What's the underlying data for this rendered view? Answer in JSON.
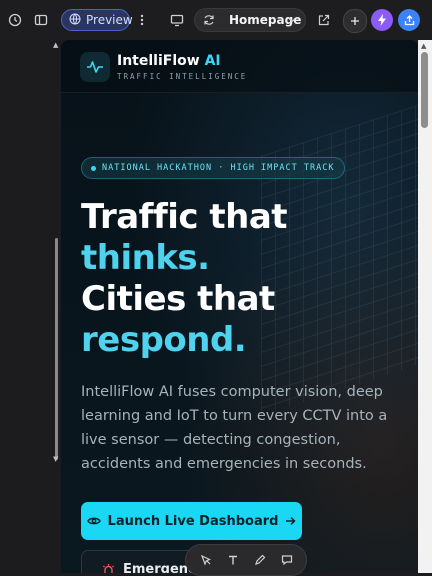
{
  "toolbar": {
    "preview_label": "Preview",
    "page_selected": "Homepage"
  },
  "site": {
    "brand_name": "IntelliFlow",
    "brand_ai": "AI",
    "tagline": "TRAFFIC INTELLIGENCE"
  },
  "hero": {
    "badge": "NATIONAL HACKATHON · HIGH IMPACT TRACK",
    "line1": "Traffic that",
    "line2": "thinks.",
    "line3": "Cities that",
    "line4": "respond.",
    "description": "IntelliFlow AI fuses computer vision, deep learning and IoT to turn every CCTV into a live sensor — detecting congestion, accidents and emergencies in seconds.",
    "cta_label": "Launch Live Dashboard",
    "secondary_label": "Emergency"
  },
  "colors": {
    "accent": "#1ad8f3",
    "highlight_text": "#4fd2ee",
    "preview_pill": "#2a3560",
    "purple_action": "#8b5cf6",
    "blue_action": "#3b82f6"
  },
  "icons": [
    "history-icon",
    "sidebar-icon",
    "globe-icon",
    "more-vertical-icon",
    "monitor-icon",
    "refresh-icon",
    "chevron-down-icon",
    "external-link-icon",
    "plus-icon",
    "lightning-icon",
    "share-icon",
    "pulse-icon",
    "eye-icon",
    "arrow-right-icon",
    "siren-icon",
    "select-icon",
    "text-icon",
    "pen-icon",
    "comment-icon"
  ]
}
